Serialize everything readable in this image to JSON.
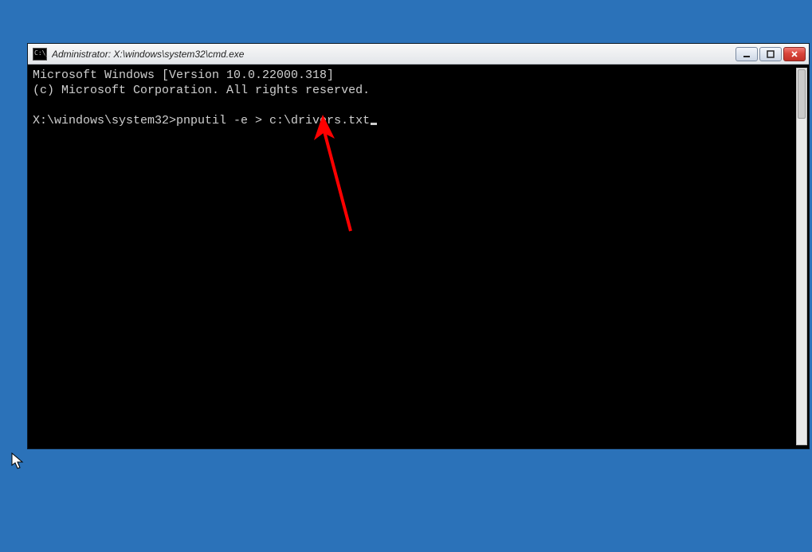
{
  "window": {
    "title": "Administrator: X:\\windows\\system32\\cmd.exe"
  },
  "terminal": {
    "line1": "Microsoft Windows [Version 10.0.22000.318]",
    "line2": "(c) Microsoft Corporation. All rights reserved.",
    "blank": "",
    "prompt": "X:\\windows\\system32>",
    "command": "pnputil -e > c:\\drivers.txt"
  },
  "controls": {
    "minimize": "minimize",
    "maximize": "maximize",
    "close": "close"
  }
}
